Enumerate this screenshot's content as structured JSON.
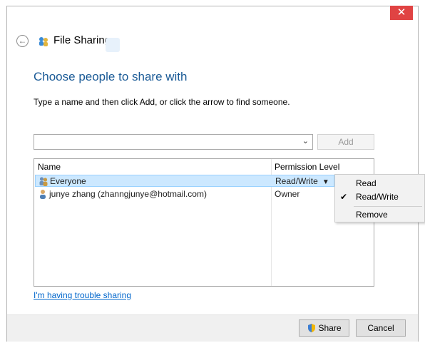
{
  "window": {
    "close_glyph": "✕",
    "back_glyph": "←",
    "title": "File Sharing"
  },
  "main": {
    "heading": "Choose people to share with",
    "instruction": "Type a name and then click Add, or click the arrow to find someone.",
    "name_input": {
      "value": "",
      "placeholder": ""
    },
    "add_label": "Add",
    "list": {
      "headers": {
        "name": "Name",
        "permission": "Permission Level"
      },
      "rows": [
        {
          "name": "Everyone",
          "permission": "Read/Write",
          "selected": true,
          "icon": "group-icon"
        },
        {
          "name": "junye zhang (zhanngjunye@hotmail.com)",
          "permission": "Owner",
          "selected": false,
          "icon": "user-icon"
        }
      ]
    },
    "context_menu": {
      "items": [
        {
          "label": "Read",
          "checked": false
        },
        {
          "label": "Read/Write",
          "checked": true
        },
        {
          "label": "Remove",
          "checked": false
        }
      ],
      "check_glyph": "✔"
    },
    "trouble_link": "I'm having trouble sharing"
  },
  "footer": {
    "share_label": "Share",
    "cancel_label": "Cancel"
  },
  "colors": {
    "accent_heading": "#1a5a96",
    "selection": "#cce8ff",
    "close_button": "#e04343",
    "link": "#0066cc"
  }
}
